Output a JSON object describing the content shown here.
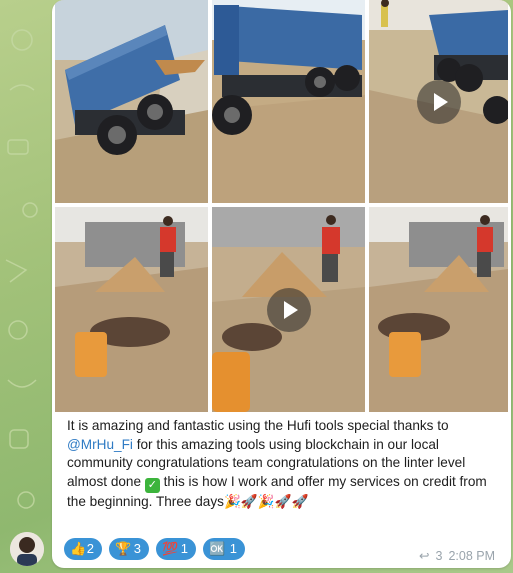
{
  "caption": {
    "text_before_mention": "It is amazing and fantastic using the Hufi tools special thanks to ",
    "mention": "@MrHu_Fi",
    "text_after_mention": " for this amazing tools using blockchain in our local community congratulations team congratulations on the linter level almost done ",
    "check_emoji": "✅",
    "text_end": " this is how I work and offer my services on credit from the beginning. Three days",
    "emoji_tail": "🎉🚀🎉🚀🚀"
  },
  "reactions": [
    {
      "icon": "👍",
      "icon_name": "thumbs-up-icon",
      "count": "2"
    },
    {
      "icon": "🏆",
      "icon_name": "trophy-icon",
      "count": "3"
    },
    {
      "icon": "💯",
      "icon_name": "hundred-points-icon",
      "count": "1"
    },
    {
      "icon": "🆗",
      "icon_name": "yes-badge-icon",
      "count": "1"
    }
  ],
  "meta": {
    "reply_icon": "↩",
    "reply_count": "3",
    "time": "2:08 PM"
  },
  "media": [
    {
      "kind": "photo",
      "subject": "blue dump truck"
    },
    {
      "kind": "photo",
      "subject": "blue dump truck"
    },
    {
      "kind": "video",
      "subject": "dump truck and worker"
    },
    {
      "kind": "photo",
      "subject": "worker shoveling sand"
    },
    {
      "kind": "video",
      "subject": "worker shoveling sand"
    },
    {
      "kind": "photo",
      "subject": "worker shoveling sand"
    }
  ],
  "colors": {
    "bubble": "#ffffff",
    "reaction_bg": "#3a93d6",
    "mention": "#2f7bc4",
    "meta": "#9aa4ac",
    "wallpaper": "#a3c27a"
  }
}
